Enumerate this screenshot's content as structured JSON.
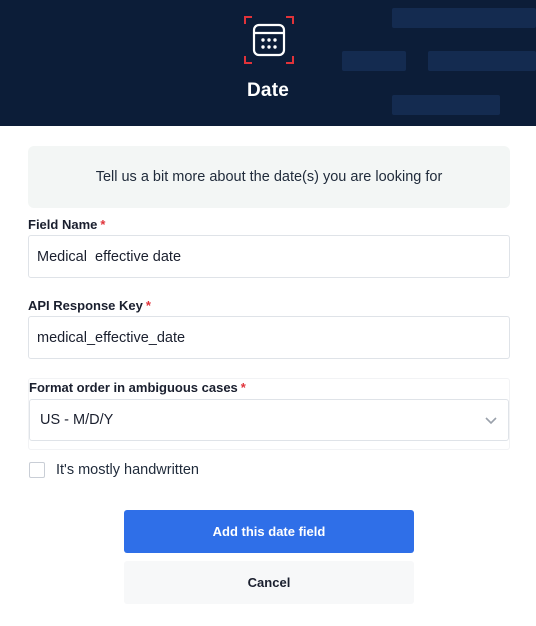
{
  "header": {
    "title": "Date",
    "icon": "calendar-icon"
  },
  "info": {
    "text": "Tell us a bit more about the date(s) you are looking for"
  },
  "fields": {
    "field_name": {
      "label": "Field Name",
      "required_mark": "*",
      "value": "Medical  effective date"
    },
    "api_key": {
      "label": "API Response Key",
      "required_mark": "*",
      "value": "medical_effective_date"
    },
    "format_order": {
      "label": "Format order in ambiguous cases",
      "required_mark": "*",
      "selected": "US - M/D/Y"
    }
  },
  "handwritten": {
    "label": "It's mostly handwritten",
    "checked": false
  },
  "buttons": {
    "primary": "Add this date field",
    "secondary": "Cancel"
  },
  "colors": {
    "header_bg": "#0c1d38",
    "accent_red": "#e0333a",
    "primary_blue": "#2f6fe8"
  }
}
